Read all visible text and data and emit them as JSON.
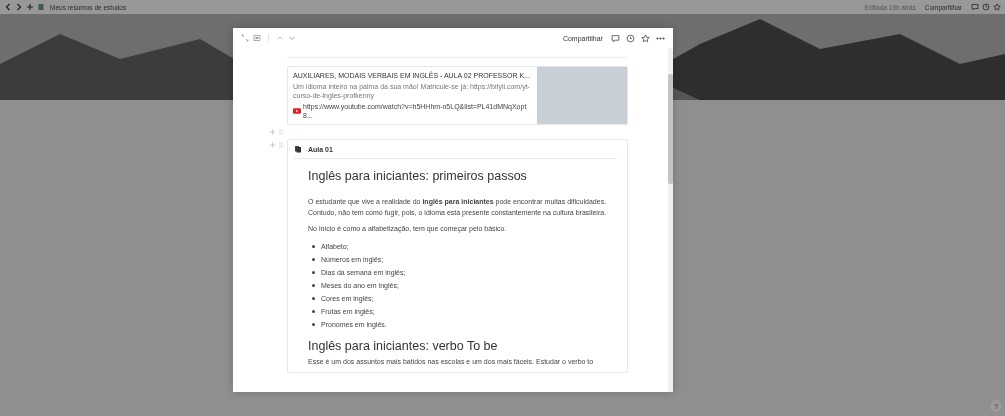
{
  "topbar": {
    "breadcrumb": "Meus resumos de estudos",
    "edited": "Editada 19h atrás",
    "share": "Compartilhar"
  },
  "modal": {
    "share": "Compartilhar",
    "bookmark": {
      "title": "AUXILIARES, MODAIS VERBAIS EM INGLÊS - AULA 02 PROFESSOR K...",
      "description": "Um idioma inteiro na palma da sua mão! Matricule-se já: https://bityli.com/yt-curso-de-ingles-profkenny",
      "url": "https://www.youtube.com/watch?v=h5HHhm-n5LQ&list=PL41dMNqXopt8..."
    },
    "callout": {
      "title": "Aula 01",
      "blocks": [
        {
          "kind": "heading",
          "text": "Inglês para iniciantes: primeiros passos"
        },
        {
          "kind": "paragraph",
          "text": "O estudante que vive a realidade do **inglês para iniciantes** pode encontrar muitas dificuldades. Contudo, não tem como fugir, pois, o idioma está presente constantemente na cultura brasileira."
        },
        {
          "kind": "paragraph",
          "text": "No início é como a alfabetização, tem que começar pelo básico."
        },
        {
          "kind": "bullets",
          "items": [
            "Alfabeto;",
            "Números em inglês;",
            "Dias da semana em inglês;",
            "Meses do ano em inglês;",
            "Cores em inglês;",
            "Frutas em inglês;",
            "Pronomes em inglês."
          ]
        },
        {
          "kind": "heading",
          "text": "Inglês para iniciantes: verbo To be"
        },
        {
          "kind": "paragraph",
          "text": "Esse é um dos assuntos mais batidos nas escolas e um dos mais fáceis. Estudar o verbo to"
        }
      ]
    }
  },
  "help": "?"
}
